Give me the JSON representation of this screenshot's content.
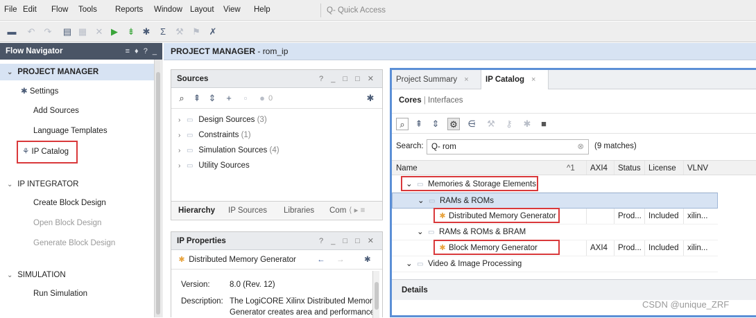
{
  "menubar": {
    "items": [
      "File",
      "Edit",
      "Flow",
      "Tools",
      "Reports",
      "Window",
      "Layout",
      "View",
      "Help"
    ],
    "quick_access": "Q- Quick Access"
  },
  "flow_navigator": {
    "title": "Flow Navigator",
    "controls": "≡ ♦ ? _",
    "sections": [
      {
        "label": "PROJECT MANAGER",
        "items": [
          "Settings",
          "Add Sources",
          "Language Templates",
          "IP Catalog"
        ]
      },
      {
        "label": "IP INTEGRATOR",
        "items": [
          "Create Block Design",
          "Open Block Design",
          "Generate Block Design"
        ]
      },
      {
        "label": "SIMULATION",
        "items": [
          "Run Simulation"
        ]
      }
    ]
  },
  "project_manager": {
    "label": "PROJECT MANAGER",
    "project": "- rom_ip"
  },
  "sources": {
    "title": "Sources",
    "controls": "? _ □ □ ✕",
    "toolbar_count": "0",
    "tree": [
      {
        "label": "Design Sources",
        "count": "(3)"
      },
      {
        "label": "Constraints",
        "count": "(1)"
      },
      {
        "label": "Simulation Sources",
        "count": "(4)"
      },
      {
        "label": "Utility Sources",
        "count": ""
      }
    ],
    "tabs": [
      "Hierarchy",
      "IP Sources",
      "Libraries",
      "Com"
    ]
  },
  "ip_properties": {
    "title": "IP Properties",
    "controls": "? _ □ □ ✕",
    "selected": "Distributed Memory Generator",
    "version_label": "Version:",
    "version_value": "8.0 (Rev. 12)",
    "description_label": "Description:",
    "description_line1": "The LogiCORE Xilinx Distributed Memory",
    "description_line2": "Generator creates area and performance"
  },
  "catalog": {
    "tabs": [
      {
        "label": "Project Summary"
      },
      {
        "label": "IP Catalog"
      }
    ],
    "subtabs": {
      "cores": "Cores",
      "sep": "|",
      "interfaces": "Interfaces"
    },
    "search_label": "Search:",
    "search_value": "Q- rom",
    "matches": "(9 matches)",
    "columns": [
      "Name",
      "AXI4",
      "Status",
      "License",
      "VLNV"
    ],
    "sort_indicator": "^1",
    "rows": [
      {
        "name": "Memories & Storage Elements",
        "axi4": "",
        "status": "",
        "license": "",
        "vlnv": ""
      },
      {
        "name": "RAMs & ROMs",
        "axi4": "",
        "status": "",
        "license": "",
        "vlnv": ""
      },
      {
        "name": "Distributed Memory Generator",
        "axi4": "",
        "status": "Prod...",
        "license": "Included",
        "vlnv": "xilin..."
      },
      {
        "name": "RAMs & ROMs & BRAM",
        "axi4": "",
        "status": "",
        "license": "",
        "vlnv": ""
      },
      {
        "name": "Block Memory Generator",
        "axi4": "AXI4",
        "status": "Prod...",
        "license": "Included",
        "vlnv": "xilin..."
      },
      {
        "name": "Video & Image Processing",
        "axi4": "",
        "status": "",
        "license": "",
        "vlnv": ""
      }
    ],
    "details": "Details"
  },
  "watermark": "CSDN @unique_ZRF",
  "colors": {
    "highlight_box": "#d9383a",
    "selected_bg": "#d7e3f3",
    "catalog_border": "#5b8fd6",
    "nav_header": "#4a5566"
  }
}
